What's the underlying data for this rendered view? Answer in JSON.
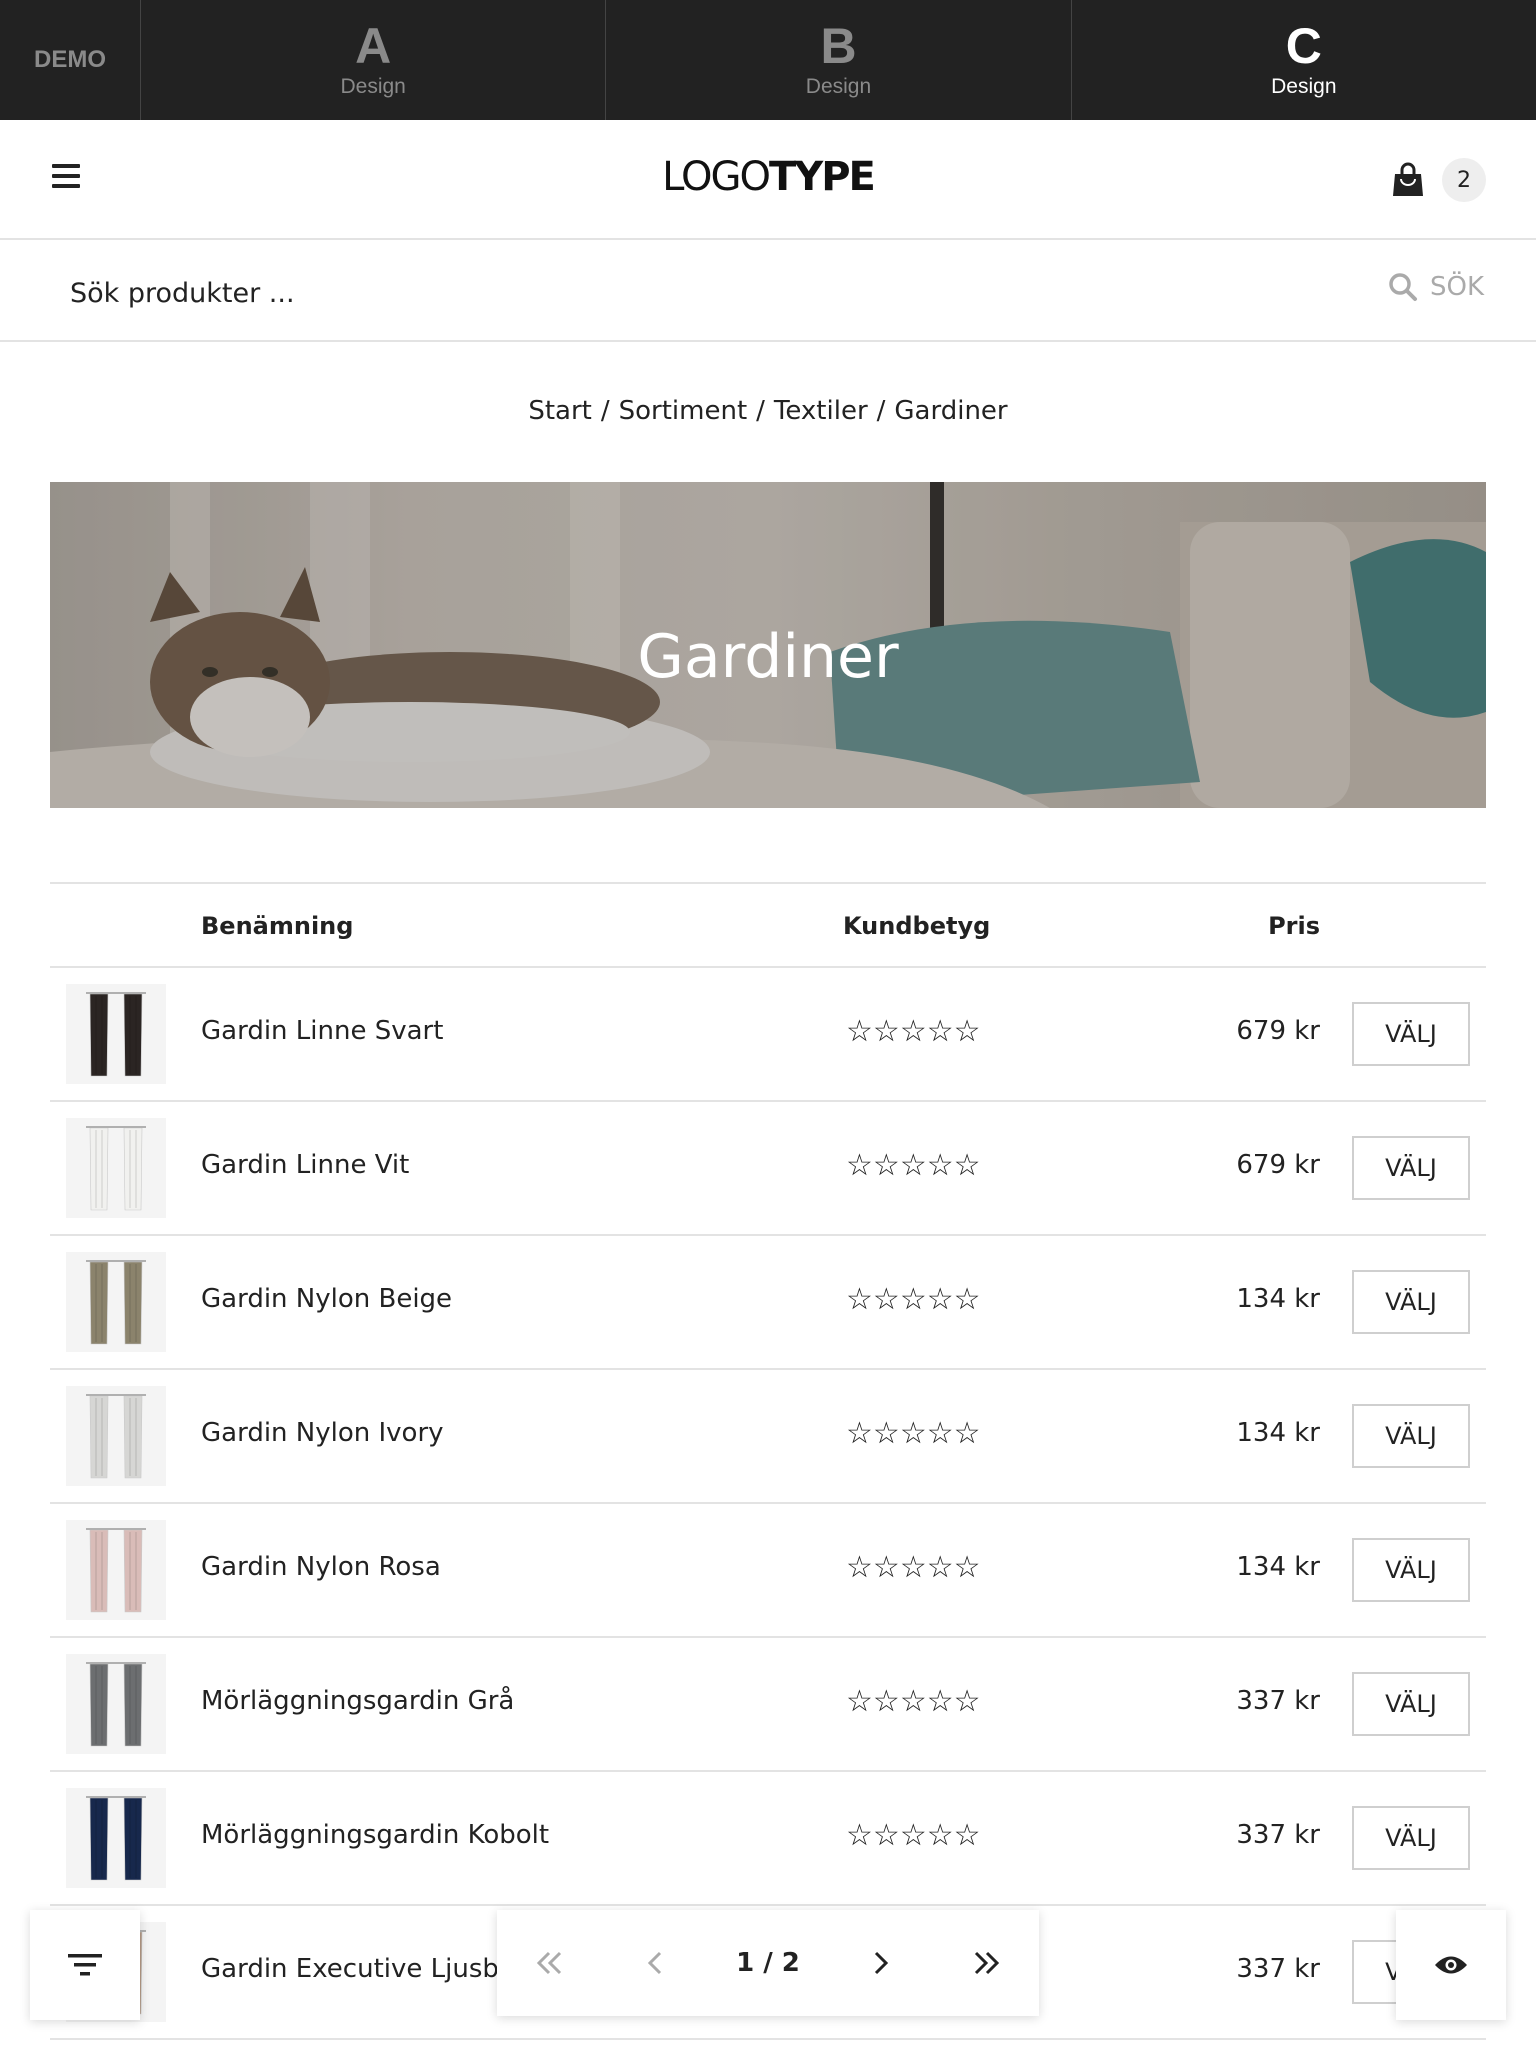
{
  "demo": {
    "label": "DEMO",
    "tabs": [
      {
        "letter": "A",
        "sub": "Design"
      },
      {
        "letter": "B",
        "sub": "Design"
      },
      {
        "letter": "C",
        "sub": "Design",
        "active": true
      }
    ]
  },
  "header": {
    "logo_light": "LOGO",
    "logo_bold": "TYPE",
    "cart_count": "2"
  },
  "search": {
    "placeholder": "Sök produkter ...",
    "button_label": "SÖK"
  },
  "breadcrumb": [
    "Start",
    "Sortiment",
    "Textiler",
    "Gardiner"
  ],
  "hero": {
    "title": "Gardiner"
  },
  "table": {
    "headers": {
      "name": "Benämning",
      "rating": "Kundbetyg",
      "price": "Pris"
    },
    "choose_label": "VÄLJ",
    "rows": [
      {
        "name": "Gardin Linne Svart",
        "price": "679 kr",
        "rating": 0,
        "color": "#2b2523"
      },
      {
        "name": "Gardin Linne Vit",
        "price": "679 kr",
        "rating": 0,
        "color": "#f1f1ef"
      },
      {
        "name": "Gardin Nylon Beige",
        "price": "134 kr",
        "rating": 0,
        "color": "#8b836c"
      },
      {
        "name": "Gardin Nylon Ivory",
        "price": "134 kr",
        "rating": 0,
        "color": "#d6d6d4"
      },
      {
        "name": "Gardin Nylon Rosa",
        "price": "134 kr",
        "rating": 0,
        "color": "#d9bcb8"
      },
      {
        "name": "Mörläggningsgardin Grå",
        "price": "337 kr",
        "rating": 0,
        "color": "#6c6e70"
      },
      {
        "name": "Mörläggningsgardin Kobolt",
        "price": "337 kr",
        "rating": 0,
        "color": "#17284c"
      },
      {
        "name": "Gardin Executive Ljusbrun",
        "price": "337 kr",
        "rating": 0,
        "color": "#b49a86"
      }
    ]
  },
  "pager": {
    "text": "1 / 2"
  },
  "colors": {
    "demo_bar": "#222222",
    "border": "#e3e3e3",
    "text": "#222222"
  }
}
